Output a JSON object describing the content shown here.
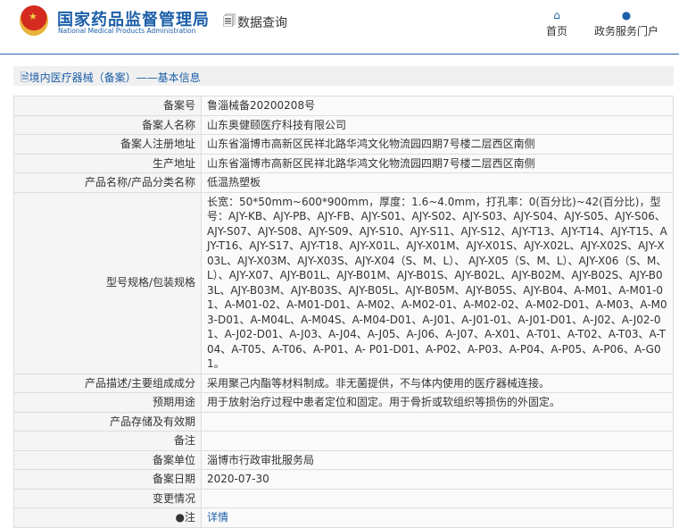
{
  "header": {
    "title": "国家药品监督管理局",
    "subtitle": "National Medical Products Administration",
    "query": "数据查询",
    "nav": [
      {
        "label": "首页",
        "icon": "home-icon"
      },
      {
        "label": "政务服务门户",
        "icon": "user-icon"
      }
    ]
  },
  "breadcrumb": "境内医疗器械（备案）——基本信息",
  "rows": [
    {
      "label": "备案号",
      "value": "鲁淄械备20200208号"
    },
    {
      "label": "备案人名称",
      "value": "山东奥健颐医疗科技有限公司"
    },
    {
      "label": "备案人注册地址",
      "value": "山东省淄博市高新区民祥北路华鸿文化物流园四期7号楼二层西区南侧"
    },
    {
      "label": "生产地址",
      "value": "山东省淄博市高新区民祥北路华鸿文化物流园四期7号楼二层西区南侧"
    },
    {
      "label": "产品名称/产品分类名称",
      "value": "低温热塑板"
    },
    {
      "label": "型号规格/包装规格",
      "value": "长宽：50*50mm~600*900mm，厚度：1.6~4.0mm，打孔率：0(百分比)~42(百分比)，型号：AJY-KB、AJY-PB、AJY-FB、AJY-S01、AJY-S02、AJY-S03、AJY-S04、AJY-S05、AJY-S06、AJY-S07、AJY-S08、AJY-S09、AJY-S10、AJY-S11、AJY-S12、AJY-T13、AJY-T14、AJY-T15、AJY-T16、AJY-S17、AJY-T18、AJY-X01L、AJY-X01M、AJY-X01S、AJY-X02L、AJY-X02S、AJY-X03L、AJY-X03M、AJY-X03S、AJY-X04（S、M、L）、 AJY-X05（S、M、L）、AJY-X06（S、M、L）、AJY-X07、AJY-B01L、AJY-B01M、AJY-B01S、AJY-B02L、AJY-B02M、AJY-B02S、AJY-B03L、AJY-B03M、AJY-B03S、AJY-B05L、AJY-B05M、AJY-B05S、AJY-B04、A-M01、A-M01-01、A-M01-02、A-M01-D01、A-M02、A-M02-01、A-M02-02、A-M02-D01、A-M03、A-M03-D01、A-M04L、A-M04S、A-M04-D01、A-J01、A-J01-01、A-J01-D01、A-J02、A-J02-01、A-J02-D01、A-J03、A-J04、A-J05、A-J06、A-J07、A-X01、A-T01、A-T02、A-T03、A-T04、A-T05、A-T06、A-P01、A- P01-D01、A-P02、A-P03、A-P04、A-P05、A-P06、A-G01。"
    },
    {
      "label": "产品描述/主要组成成分",
      "value": "采用聚己内酯等材料制成。非无菌提供，不与体内使用的医疗器械连接。"
    },
    {
      "label": "预期用途",
      "value": "用于放射治疗过程中患者定位和固定。用于骨折或软组织等损伤的外固定。"
    },
    {
      "label": "产品存储及有效期",
      "value": ""
    },
    {
      "label": "备注",
      "value": ""
    },
    {
      "label": "备案单位",
      "value": "淄博市行政审批服务局"
    },
    {
      "label": "备案日期",
      "value": "2020-07-30"
    },
    {
      "label": "变更情况",
      "value": ""
    }
  ],
  "note": {
    "label": "注",
    "link": "详情"
  }
}
